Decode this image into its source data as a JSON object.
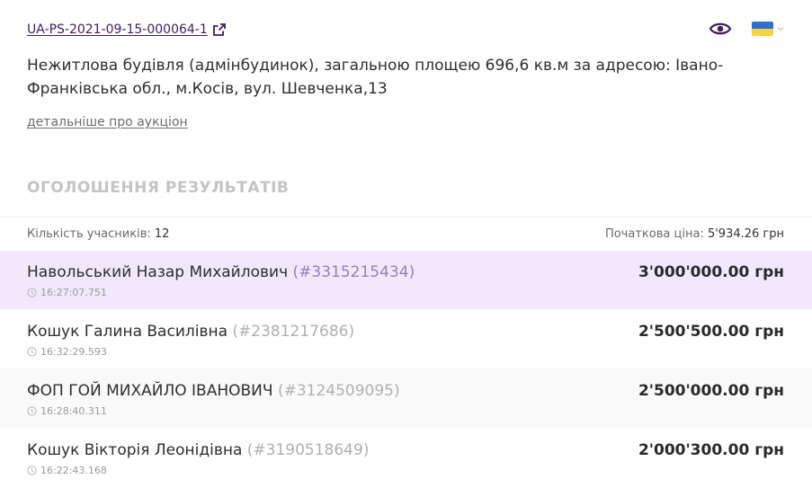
{
  "header": {
    "auction_id": "UA-PS-2021-09-15-000064-1",
    "title": "Нежитлова будівля (адмінбудинок), загальною площею 696,6 кв.м за адресою: Івано-Франківська обл., м.Косів, вул. Шевченка,13",
    "details_link": "детальніше про аукціон",
    "icons": [
      "external-link-icon",
      "eye-icon",
      "ukraine-flag-icon",
      "chevron-down-icon"
    ],
    "flag_colors": {
      "blue": "#2d6fd6",
      "yellow": "#f8d33a"
    },
    "accent_color": "#3b1f5e"
  },
  "results": {
    "section_title": "ОГОЛОШЕННЯ РЕЗУЛЬТАТІВ",
    "participants_label": "Кількість учасників:",
    "participants_value": "12",
    "start_price_label": "Початкова ціна:",
    "start_price_value": "5'934.26 грн",
    "bids": [
      {
        "name": "Навольський Назар Михайлович",
        "id": "(#3315215434)",
        "time": "16:27:07.751",
        "amount": "3'000'000.00 грн"
      },
      {
        "name": "Кошук Галина Василівна",
        "id": "(#2381217686)",
        "time": "16:32:29.593",
        "amount": "2'500'500.00 грн"
      },
      {
        "name": "ФОП ГОЙ МИХАЙЛО ІВАНОВИЧ",
        "id": "(#3124509095)",
        "time": "16:28:40.311",
        "amount": "2'500'000.00 грн"
      },
      {
        "name": "Кошук Вікторія Леонідівна",
        "id": "(#3190518649)",
        "time": "16:22:43.168",
        "amount": "2'000'300.00 грн"
      }
    ]
  }
}
